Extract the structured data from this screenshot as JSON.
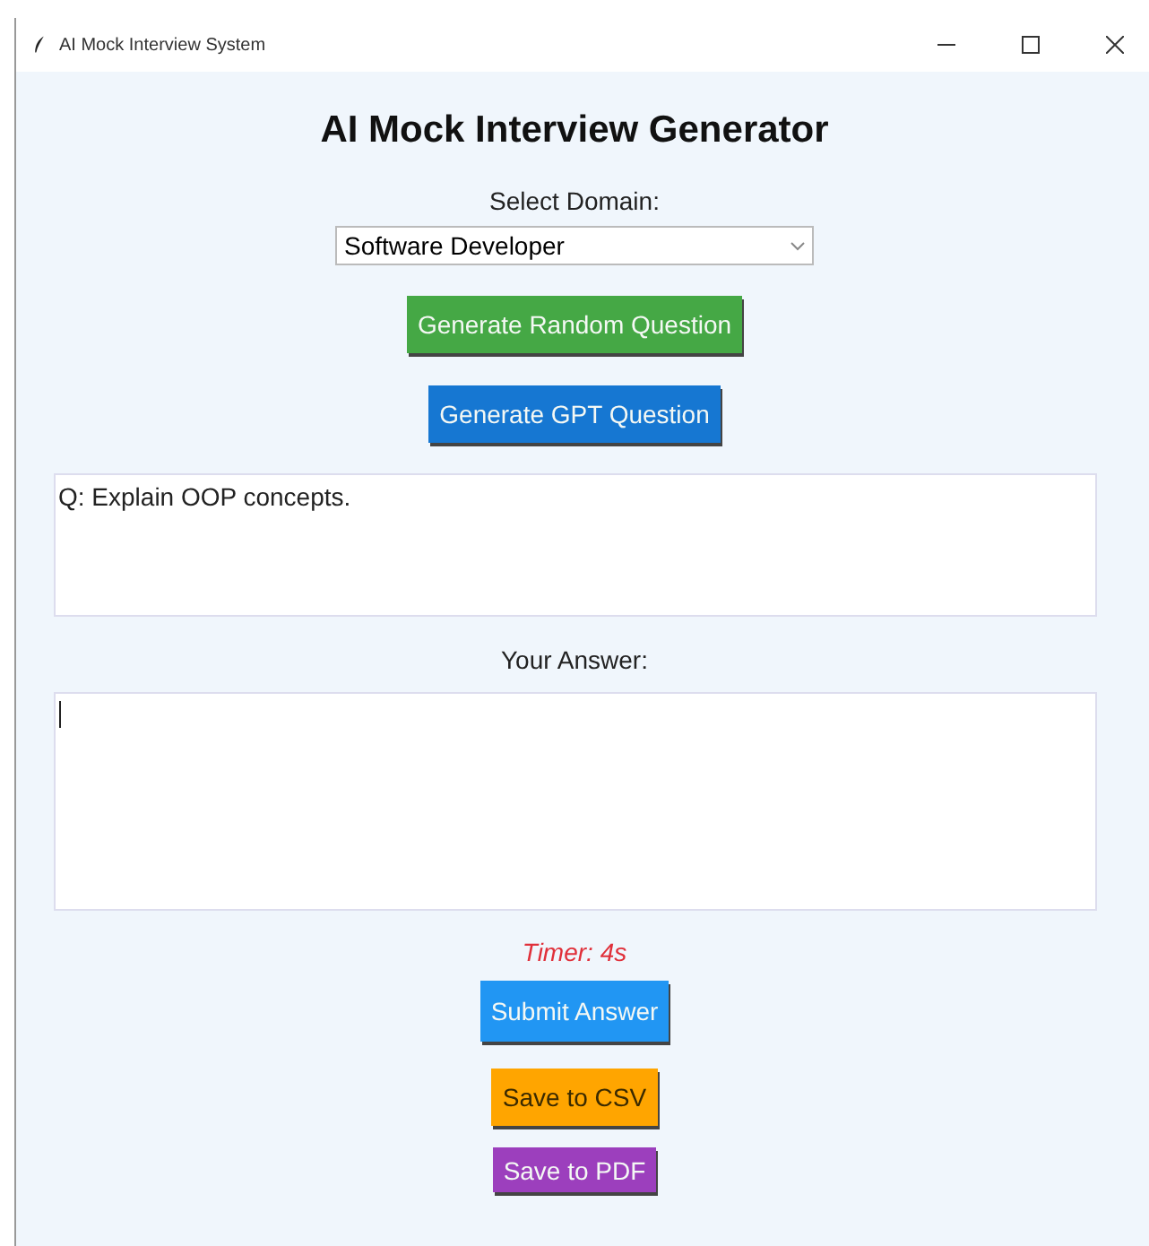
{
  "window": {
    "title": "AI Mock Interview System"
  },
  "heading": "AI Mock Interview Generator",
  "domain": {
    "label": "Select Domain:",
    "value": "Software Developer"
  },
  "question_buttons": [
    {
      "label": "Generate Random Question",
      "color": "#45a845"
    },
    {
      "label": "Generate GPT Question",
      "color": "#1677d2"
    }
  ],
  "question_text": "Q: Explain OOP concepts.",
  "answer": {
    "label": "Your Answer:",
    "focused": true
  },
  "timer": "Timer: 4s",
  "action_buttons": [
    {
      "label": "Submit Answer",
      "color": "#2196f3"
    },
    {
      "label": "Save to CSV",
      "color": "#ffa500"
    },
    {
      "label": "Save to PDF",
      "color": "#9c3fbd"
    }
  ]
}
